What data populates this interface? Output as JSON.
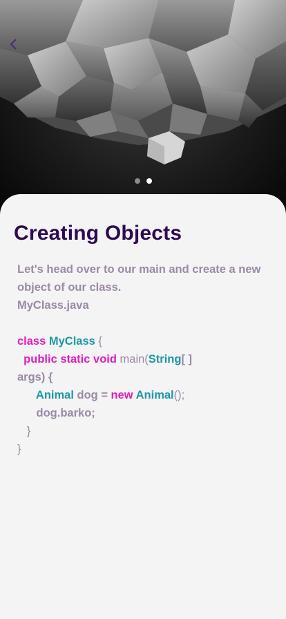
{
  "header": {
    "back_icon": "chevron-left-icon"
  },
  "carousel": {
    "total": 2,
    "active_index": 1
  },
  "lesson": {
    "title": "Creating Objects",
    "intro_line1": "Let's head over to our main and create a new",
    "intro_line2": "object of our class.",
    "file_name": "MyClass.java"
  },
  "code": {
    "l1": {
      "kw": "class",
      "type": "MyClass",
      "rest": " {"
    },
    "l2": {
      "kw": "public static void",
      "fn": " main(",
      "type": "String",
      "rest": "[ ]"
    },
    "l3": {
      "rest": "args) {"
    },
    "l4": {
      "type1": "Animal",
      "mid": " dog = ",
      "kw": "new",
      "type2": " Animal",
      "rest": "();"
    },
    "l5": {
      "rest": "dog.barko;"
    },
    "l6": {
      "rest": "}"
    },
    "l7": {
      "rest": "}"
    }
  },
  "colors": {
    "title": "#2d0a52",
    "keyword": "#e01ec0",
    "type": "#1b98a8",
    "text": "#9a8aa6"
  }
}
